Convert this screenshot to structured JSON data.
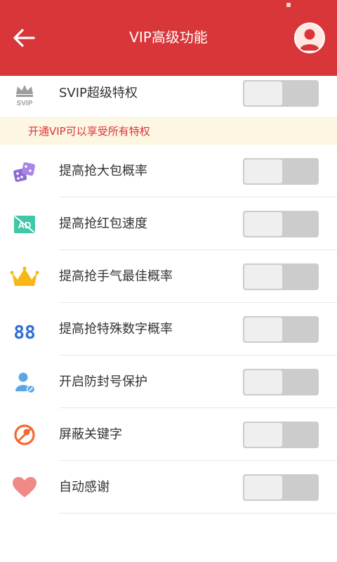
{
  "header": {
    "title": "VIP高级功能",
    "back_icon": "arrow-left-icon",
    "avatar_icon": "user-avatar-icon",
    "color": "#d9363a"
  },
  "svip": {
    "label": "SVIP超级特权",
    "icon": "svip-crown-icon",
    "icon_text": "SVIP",
    "enabled": false
  },
  "notice": {
    "text": "开通VIP可以享受所有特权"
  },
  "features": [
    {
      "label": "提高抢大包概率",
      "icon": "dice-icon",
      "enabled": false
    },
    {
      "label": "提高抢红包速度",
      "icon": "ad-block-icon",
      "icon_text": "AD",
      "enabled": false
    },
    {
      "label": "提高抢手气最佳概率",
      "icon": "crown-icon",
      "enabled": false
    },
    {
      "label": "提高抢特殊数字概率",
      "icon": "digits-icon",
      "icon_text": "88",
      "enabled": false
    },
    {
      "label": "开启防封号保护",
      "icon": "user-shield-icon",
      "enabled": false
    },
    {
      "label": "屏蔽关键字",
      "icon": "blocked-keyword-icon",
      "enabled": false
    },
    {
      "label": "自动感谢",
      "icon": "heart-icon",
      "enabled": false
    }
  ]
}
